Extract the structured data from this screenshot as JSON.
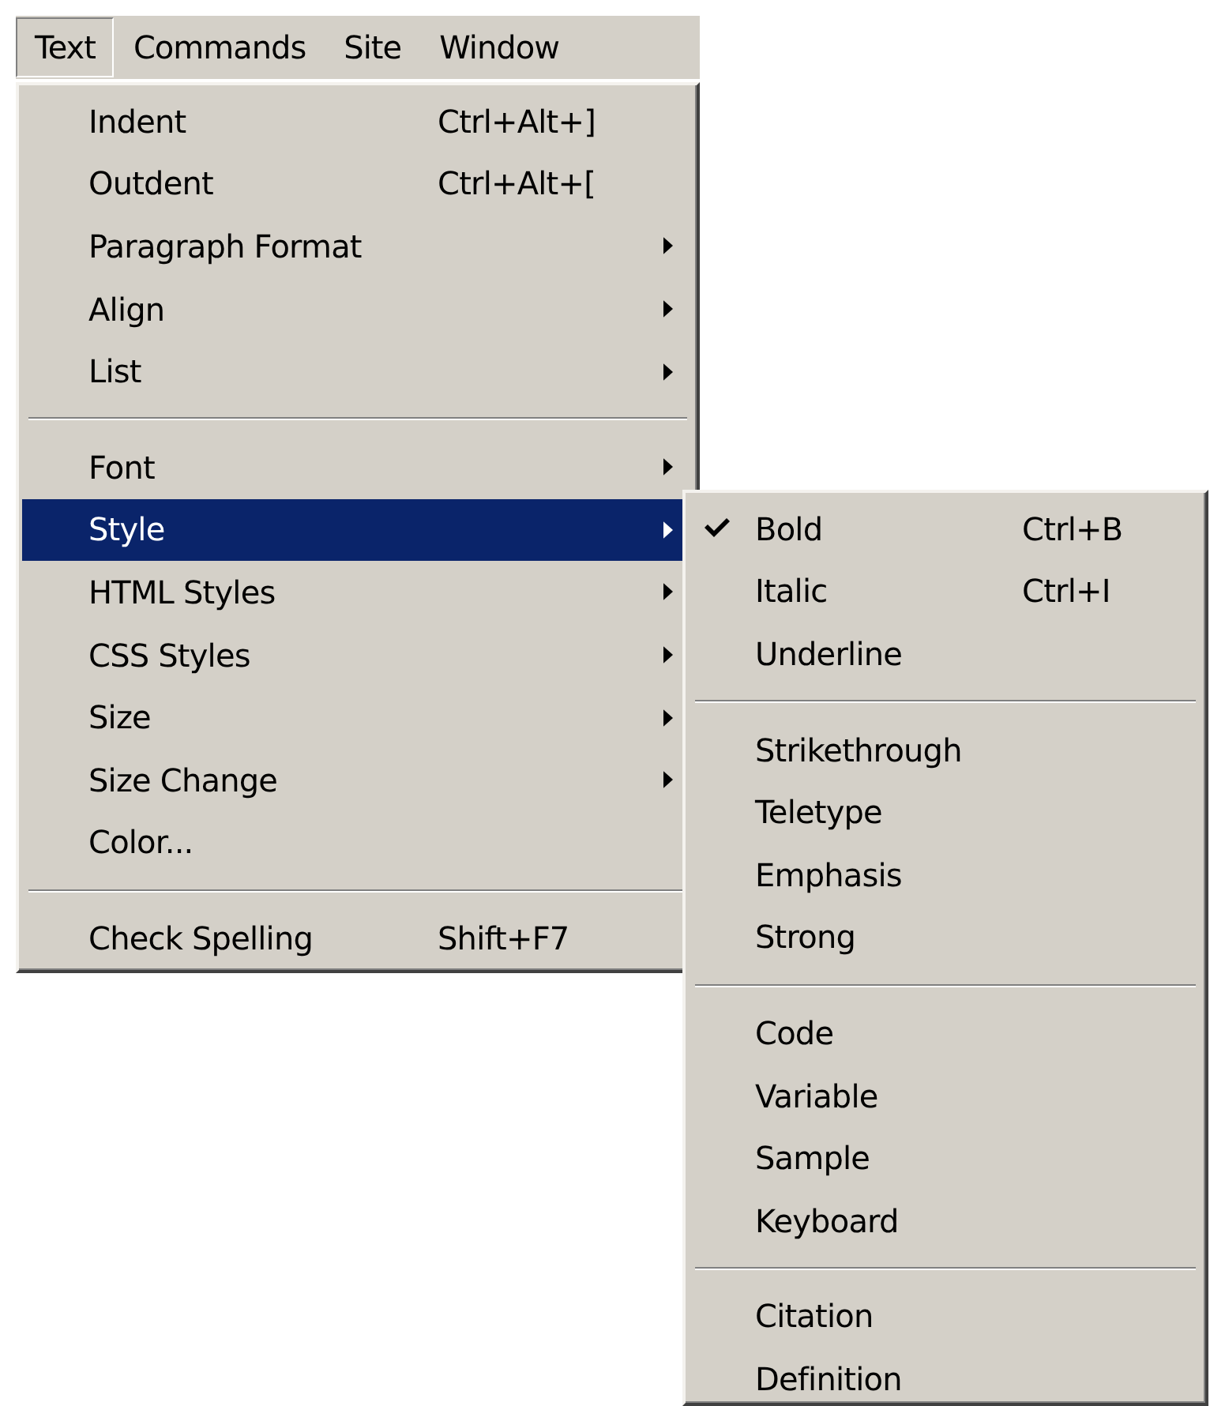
{
  "menubar": [
    {
      "label": "Text",
      "selected": true
    },
    {
      "label": "Commands",
      "selected": false
    },
    {
      "label": "Site",
      "selected": false
    },
    {
      "label": "Window",
      "selected": false
    }
  ],
  "menu": {
    "groups": [
      [
        {
          "label": "Indent",
          "shortcut": "Ctrl+Alt+]",
          "submenu": false,
          "selected": false
        },
        {
          "label": "Outdent",
          "shortcut": "Ctrl+Alt+[",
          "submenu": false,
          "selected": false
        },
        {
          "label": "Paragraph Format",
          "submenu": true,
          "selected": false
        },
        {
          "label": "Align",
          "submenu": true,
          "selected": false
        },
        {
          "label": "List",
          "submenu": true,
          "selected": false
        }
      ],
      [
        {
          "label": "Font",
          "submenu": true,
          "selected": false
        },
        {
          "label": "Style",
          "submenu": true,
          "selected": true
        },
        {
          "label": "HTML Styles",
          "submenu": true,
          "selected": false
        },
        {
          "label": "CSS Styles",
          "submenu": true,
          "selected": false
        },
        {
          "label": "Size",
          "submenu": true,
          "selected": false
        },
        {
          "label": "Size Change",
          "submenu": true,
          "selected": false
        },
        {
          "label": "Color...",
          "submenu": false,
          "selected": false
        }
      ],
      [
        {
          "label": "Check Spelling",
          "shortcut": "Shift+F7",
          "submenu": false,
          "selected": false
        }
      ]
    ]
  },
  "submenu": {
    "groups": [
      [
        {
          "label": "Bold",
          "shortcut": "Ctrl+B",
          "checked": true
        },
        {
          "label": "Italic",
          "shortcut": "Ctrl+I",
          "checked": false
        },
        {
          "label": "Underline",
          "checked": false
        }
      ],
      [
        {
          "label": "Strikethrough",
          "checked": false
        },
        {
          "label": "Teletype",
          "checked": false
        },
        {
          "label": "Emphasis",
          "checked": false
        },
        {
          "label": "Strong",
          "checked": false
        }
      ],
      [
        {
          "label": "Code",
          "checked": false
        },
        {
          "label": "Variable",
          "checked": false
        },
        {
          "label": "Sample",
          "checked": false
        },
        {
          "label": "Keyboard",
          "checked": false
        }
      ],
      [
        {
          "label": "Citation",
          "checked": false
        },
        {
          "label": "Definition",
          "checked": false
        }
      ]
    ]
  }
}
